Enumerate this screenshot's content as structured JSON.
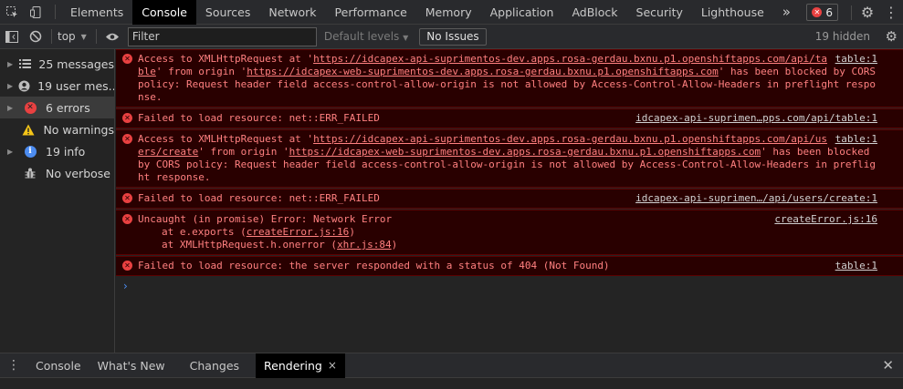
{
  "topbar": {
    "tabs": [
      "Elements",
      "Console",
      "Sources",
      "Network",
      "Performance",
      "Memory",
      "Application",
      "AdBlock",
      "Security",
      "Lighthouse"
    ],
    "more_icon": "»",
    "error_badge_count": "6"
  },
  "toolbar": {
    "context": "top",
    "filter_placeholder": "Filter",
    "levels_label": "Default levels",
    "no_issues_label": "No Issues",
    "hidden_count": "19 hidden"
  },
  "sidebar": {
    "items": [
      {
        "label": "25 messages",
        "icon": "list-icon"
      },
      {
        "label": "19 user mes...",
        "icon": "user-icon"
      },
      {
        "label": "6 errors",
        "icon": "error-icon"
      },
      {
        "label": "No warnings",
        "icon": "warning-icon"
      },
      {
        "label": "19 info",
        "icon": "info-icon"
      },
      {
        "label": "No verbose",
        "icon": "bug-icon"
      }
    ]
  },
  "messages": [
    {
      "source": "table:1",
      "p1": "Access to XMLHttpRequest at '",
      "link1": "https://idcapex-api-suprimentos-dev.apps.rosa-gerdau.bxnu.p1.openshiftapps.com/api/table",
      "p2": "' from origin '",
      "link2": "https://idcapex-web-suprimentos-dev.apps.rosa-gerdau.bxnu.p1.openshiftapps.com",
      "p3": "' has been blocked by CORS policy: Request header field access-control-allow-origin is not allowed by Access-Control-Allow-Headers in preflight response."
    },
    {
      "source": "idcapex-api-suprimen…pps.com/api/table:1",
      "text": "Failed to load resource: net::ERR_FAILED"
    },
    {
      "source": "table:1",
      "p1": "Access to XMLHttpRequest at '",
      "link1": "https://idcapex-api-suprimentos-dev.apps.rosa-gerdau.bxnu.p1.openshiftapps.com/api/users/create",
      "p2": "' from origin '",
      "link2": "https://idcapex-web-suprimentos-dev.apps.rosa-gerdau.bxnu.p1.openshiftapps.com",
      "p3": "' has been blocked by CORS policy: Request header field access-control-allow-origin is not allowed by Access-Control-Allow-Headers in preflight response."
    },
    {
      "source": "idcapex-api-suprimen…/api/users/create:1",
      "text": "Failed to load resource: net::ERR_FAILED"
    },
    {
      "source": "createError.js:16",
      "text": "Uncaught (in promise) Error: Network Error",
      "stack1_prefix": "at e.exports (",
      "stack1_link": "createError.js:16",
      "stack1_suffix": ")",
      "stack2_prefix": "at XMLHttpRequest.h.onerror (",
      "stack2_link": "xhr.js:84",
      "stack2_suffix": ")"
    },
    {
      "source": "table:1",
      "text": "Failed to load resource: the server responded with a status of 404 (Not Found)"
    }
  ],
  "prompt_symbol": "›",
  "drawer": {
    "tabs": [
      "Console",
      "What's New",
      "Changes",
      "Rendering"
    ],
    "close_tab_icon": "×",
    "close_icon": "✕"
  },
  "colors": {
    "error_bg": "#290000",
    "error_border": "#5c0000",
    "error_text": "#ff8080",
    "error_icon": "#e94141",
    "warning": "#f5c518",
    "info": "#4c8cf0"
  }
}
